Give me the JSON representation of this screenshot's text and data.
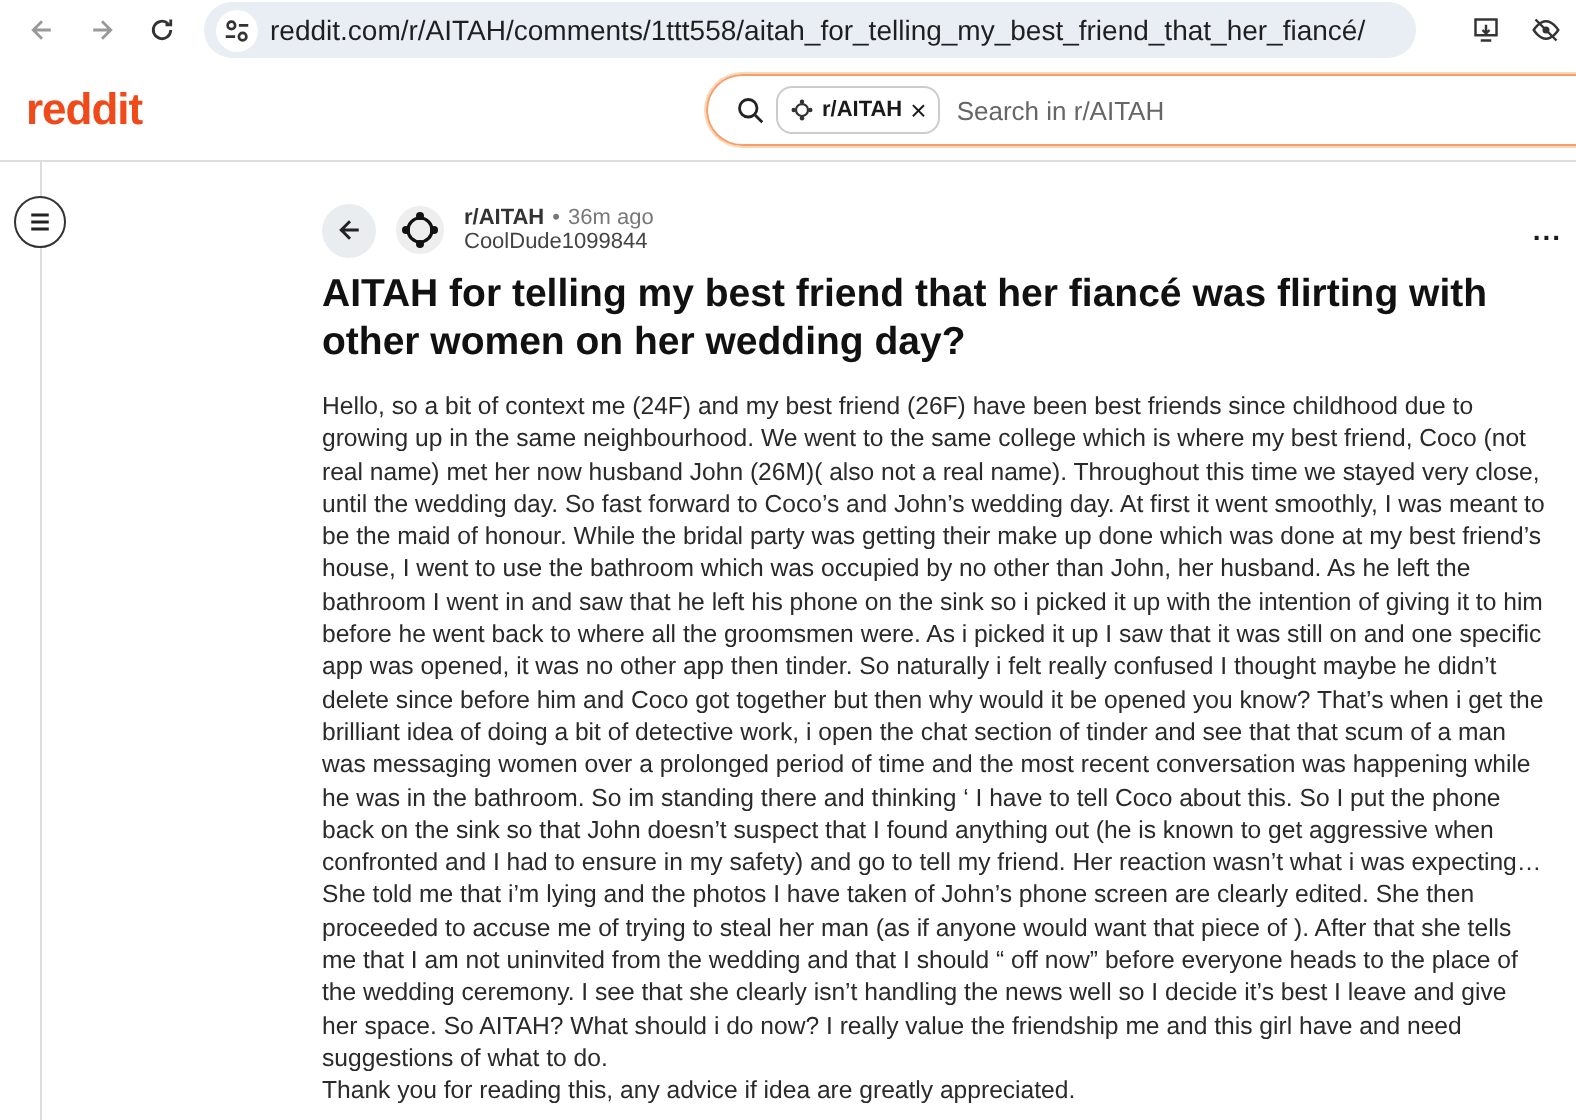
{
  "browser": {
    "url": "reddit.com/r/AITAH/comments/1ttt558/aitah_for_telling_my_best_friend_that_her_fiancé/"
  },
  "header": {
    "logo": "reddit",
    "search": {
      "chip": "r/AITAH",
      "chip_close": "×",
      "placeholder": "Search in r/AITAH"
    }
  },
  "post": {
    "subreddit": "r/AITAH",
    "separator": "•",
    "time": "36m ago",
    "author": "CoolDude1099844",
    "more": "...",
    "title": "AITAH for telling my best friend that her fiancé was flirting with other women on her wedding day?",
    "paragraphs": [
      "Hello, so a bit of context me (24F) and my best friend (26F) have been best friends since childhood due to growing up in the same neighbourhood. We went to the same college which is where my best friend, Coco (not real name) met her now husband John (26M)( also not a real name). Throughout this time we stayed very close, until the wedding day. So fast forward to Coco’s and John’s wedding day. At first it went smoothly, I was meant to be the maid of honour. While the bridal party was getting their make up done which was done at my best friend’s house, I went to use the bathroom which was occupied by no other than John, her husband. As he left the bathroom I went in and saw that he left his phone on the sink so i picked it up with the intention of giving it to him before he went back to where all the groomsmen were. As i picked it up I saw that it was still on and one specific app was opened, it was no other app then tinder. So naturally i felt really confused I thought maybe he didn’t delete since before him and Coco got together but then why would it be opened you know? That’s when i get the brilliant idea of doing a bit of detective work, i open the chat section of tinder and see that that scum of a man was messaging women over a prolonged period of time and the most recent conversation was happening while he was in the bathroom. So im standing there and thinking ‘ I have to tell Coco about this. So I put the phone back on the sink so that John doesn’t suspect that I found anything out (he is known to get aggressive when confronted and I had to ensure in my safety) and go to tell my friend. Her reaction wasn’t what i was expecting… She told me that i’m lying and the photos I have taken of John’s phone screen are clearly edited. She then proceeded to accuse me of trying to steal her man (as if anyone would want that piece of ). After that she tells me that I am not uninvited from the wedding and that I should “ off now” before everyone heads to the place of the wedding ceremony. I see that she clearly isn’t handling the news well so I decide it’s best I leave and give her space. So AITAH? What should i do now? I really value the friendship me and this girl have and need suggestions of what to do.",
      "Thank you for reading this, any advice if idea are greatly appreciated."
    ]
  }
}
